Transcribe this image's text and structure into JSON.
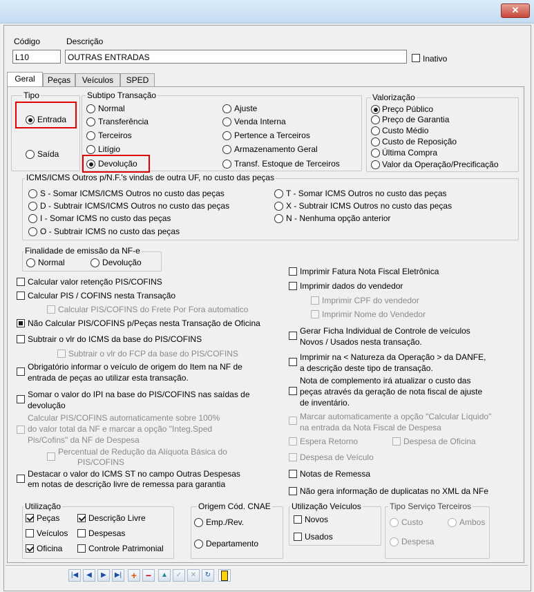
{
  "header": {
    "codigo_label": "Código",
    "descricao_label": "Descrição",
    "codigo_value": "L10",
    "descricao_value": "OUTRAS ENTRADAS",
    "inativo_label": "Inativo"
  },
  "tabs": [
    "Geral",
    "Peças",
    "Veículos",
    "SPED"
  ],
  "tipo": {
    "title": "Tipo",
    "entrada": "Entrada",
    "saida": "Saída"
  },
  "subtipo": {
    "title": "Subtipo Transação",
    "col1": [
      "Normal",
      "Transferência",
      "Terceiros",
      "Litígio",
      "Devolução"
    ],
    "col2": [
      "Ajuste",
      "Venda Interna",
      "Pertence a Terceiros",
      "Armazenamento Geral",
      "Transf. Estoque de Terceiros"
    ]
  },
  "valorizacao": {
    "title": "Valorização",
    "options": [
      "Preço Público",
      "Preço de Garantia",
      "Custo Médio",
      "Custo de Reposição",
      "Última Compra",
      "Valor da Operação/Precificação"
    ]
  },
  "icms": {
    "title": "ICMS/ICMS Outros p/N.F.'s vindas de outra UF, no custo das peças",
    "left": [
      "S - Somar ICMS/ICMS Outros no custo das peças",
      "D - Subtrair ICMS/ICMS Outros no custo das peças",
      "I - Somar ICMS no custo das peças",
      "O - Subtrair ICMS no custo das peças"
    ],
    "right": [
      "T - Somar ICMS Outros no custo das peças",
      "X - Subtrair ICMS Outros no custo das peças",
      "N - Nenhuma opção anterior"
    ]
  },
  "finalidade": {
    "title": "Finalidade de emissão da NF-e",
    "normal": "Normal",
    "devolucao": "Devolução"
  },
  "left_checks": {
    "retencao": "Calcular valor retenção PIS/COFINS",
    "calc_pis": "Calcular PIS / COFINS nesta Transação",
    "frete": "Calcular PIS/COFINS do Frete Por Fora automatico",
    "nao_calc": "Não Calcular PIS/COFINS p/Peças nesta Transação de Oficina",
    "subtrair_icms": "Subtrair o vlr do ICMS da base do PIS/COFINS",
    "subtrair_fcp": "Subtrair o vlr do FCP da base do PIS/COFINS",
    "obrig_1": "Obrigatório informar o veículo de origem do Item na NF de",
    "obrig_2": "entrada de peças ao utilizar esta transação.",
    "ipi_1": "Somar o valor do IPI na base do PIS/COFINS nas saídas de",
    "ipi_2": "devolução",
    "auto_1": "Calcular PIS/COFINS automaticamente sobre 100%",
    "auto_2": "do valor total da NF e marcar a opção \"Integ.Sped",
    "auto_3": "Pis/Cofins\" da NF de Despesa",
    "perc_1": "Percentual de Redução da Alíquota Básica do",
    "perc_2": "PIS/COFINS",
    "st_1": "Destacar o valor do ICMS ST no campo Outras Despesas",
    "st_2": "em notas de descrição livre de remessa para garantia"
  },
  "right_checks": {
    "fatura": "Imprimir Fatura Nota Fiscal Eletrônica",
    "vendedor": "Imprimir dados do vendedor",
    "cpf": "Imprimir CPF do vendedor",
    "nome": "Imprimir Nome do Vendedor",
    "ficha_1": "Gerar Ficha Individual de Controle de veículos",
    "ficha_2": "Novos / Usados  nesta transação.",
    "natureza_1": "Imprimir na < Natureza da Operação > da DANFE,",
    "natureza_2": "a descrição deste tipo de transação.",
    "compl_1": "Nota de complemento irá atualizar o custo das",
    "compl_2": "peças através da geração de nota fiscal de ajuste",
    "compl_3": "de inventário.",
    "liquido_1": "Marcar automaticamente a opção \"Calcular Líquido\"",
    "liquido_2": "na entrada da Nota Fiscal de Despesa",
    "espera": "Espera Retorno",
    "desp_oficina": "Despesa de Oficina",
    "desp_veiculo": "Despesa de Veículo",
    "remessa": "Notas de Remessa",
    "duplicatas": "Não gera informação de duplicatas no XML da NFe"
  },
  "utilizacao": {
    "title": "Utilização",
    "pecas": "Peças",
    "descricao_livre": "Descrição Livre",
    "veiculos": "Veículos",
    "despesas": "Despesas",
    "oficina": "Oficina",
    "controle": "Controle Patrimonial"
  },
  "origem": {
    "title": "Origem Cód. CNAE",
    "emp": "Emp./Rev.",
    "depto": "Departamento"
  },
  "util_veic": {
    "title": "Utilização Veículos",
    "novos": "Novos",
    "usados": "Usados"
  },
  "tipo_servico": {
    "title": "Tipo Serviço Terceiros",
    "custo": "Custo",
    "ambos": "Ambos",
    "despesa": "Despesa"
  },
  "title_close": "✕",
  "colors": {
    "highlight": "#e00000",
    "titlebar": "#c4dbf1"
  }
}
